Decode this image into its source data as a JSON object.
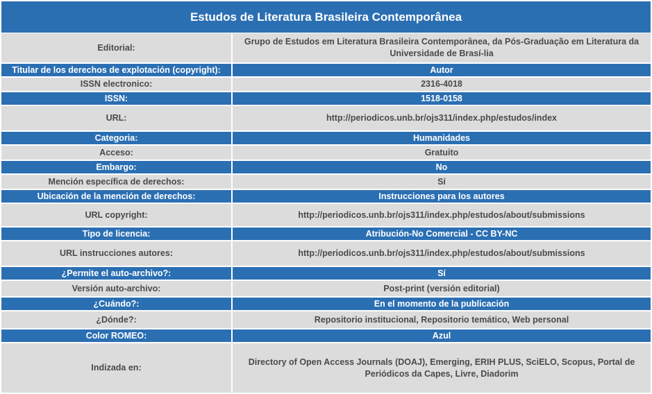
{
  "title": "Estudos de Literatura Brasileira Contemporânea",
  "rows": [
    {
      "label": "Editorial:",
      "value": "Grupo de Estudos em Literatura Brasileira Contemporânea, da Pós-Graduação em Literatura da Universidade de Brasí-lia"
    },
    {
      "label": "Titular de los derechos de explotación (copyright):",
      "value": "Autor"
    },
    {
      "label": "ISSN electronico:",
      "value": "2316-4018"
    },
    {
      "label": "ISSN:",
      "value": "1518-0158"
    },
    {
      "label": "URL:",
      "value": "http://periodicos.unb.br/ojs311/index.php/estudos/index"
    },
    {
      "label": "Categoria:",
      "value": "Humanidades"
    },
    {
      "label": "Acceso:",
      "value": "Gratuito"
    },
    {
      "label": "Embargo:",
      "value": "No"
    },
    {
      "label": "Mención específica de derechos:",
      "value": "Sí"
    },
    {
      "label": "Ubicación de la mención de derechos:",
      "value": "Instrucciones para los autores"
    },
    {
      "label": "URL copyright:",
      "value": "http://periodicos.unb.br/ojs311/index.php/estudos/about/submissions"
    },
    {
      "label": "Tipo de licencia:",
      "value": "Atribución-No Comercial - CC BY-NC"
    },
    {
      "label": "URL instrucciones autores:",
      "value": "http://periodicos.unb.br/ojs311/index.php/estudos/about/submissions"
    },
    {
      "label": "¿Permite el auto-archivo?:",
      "value": "Sí"
    },
    {
      "label": "Versión auto-archivo:",
      "value": "Post-print (versión editorial)"
    },
    {
      "label": "¿Cuándo?:",
      "value": "En el momento de la publicación"
    },
    {
      "label": "¿Dónde?:",
      "value": "Repositorio institucional, Repositorio temático, Web personal"
    },
    {
      "label": "Color ROMEO:",
      "value": "Azul"
    },
    {
      "label": "Indizada en:",
      "value": "Directory of Open Access Journals (DOAJ), Emerging, ERIH PLUS, SciELO, Scopus, Portal de Periódicos da Capes, Livre, Diadorim"
    }
  ]
}
